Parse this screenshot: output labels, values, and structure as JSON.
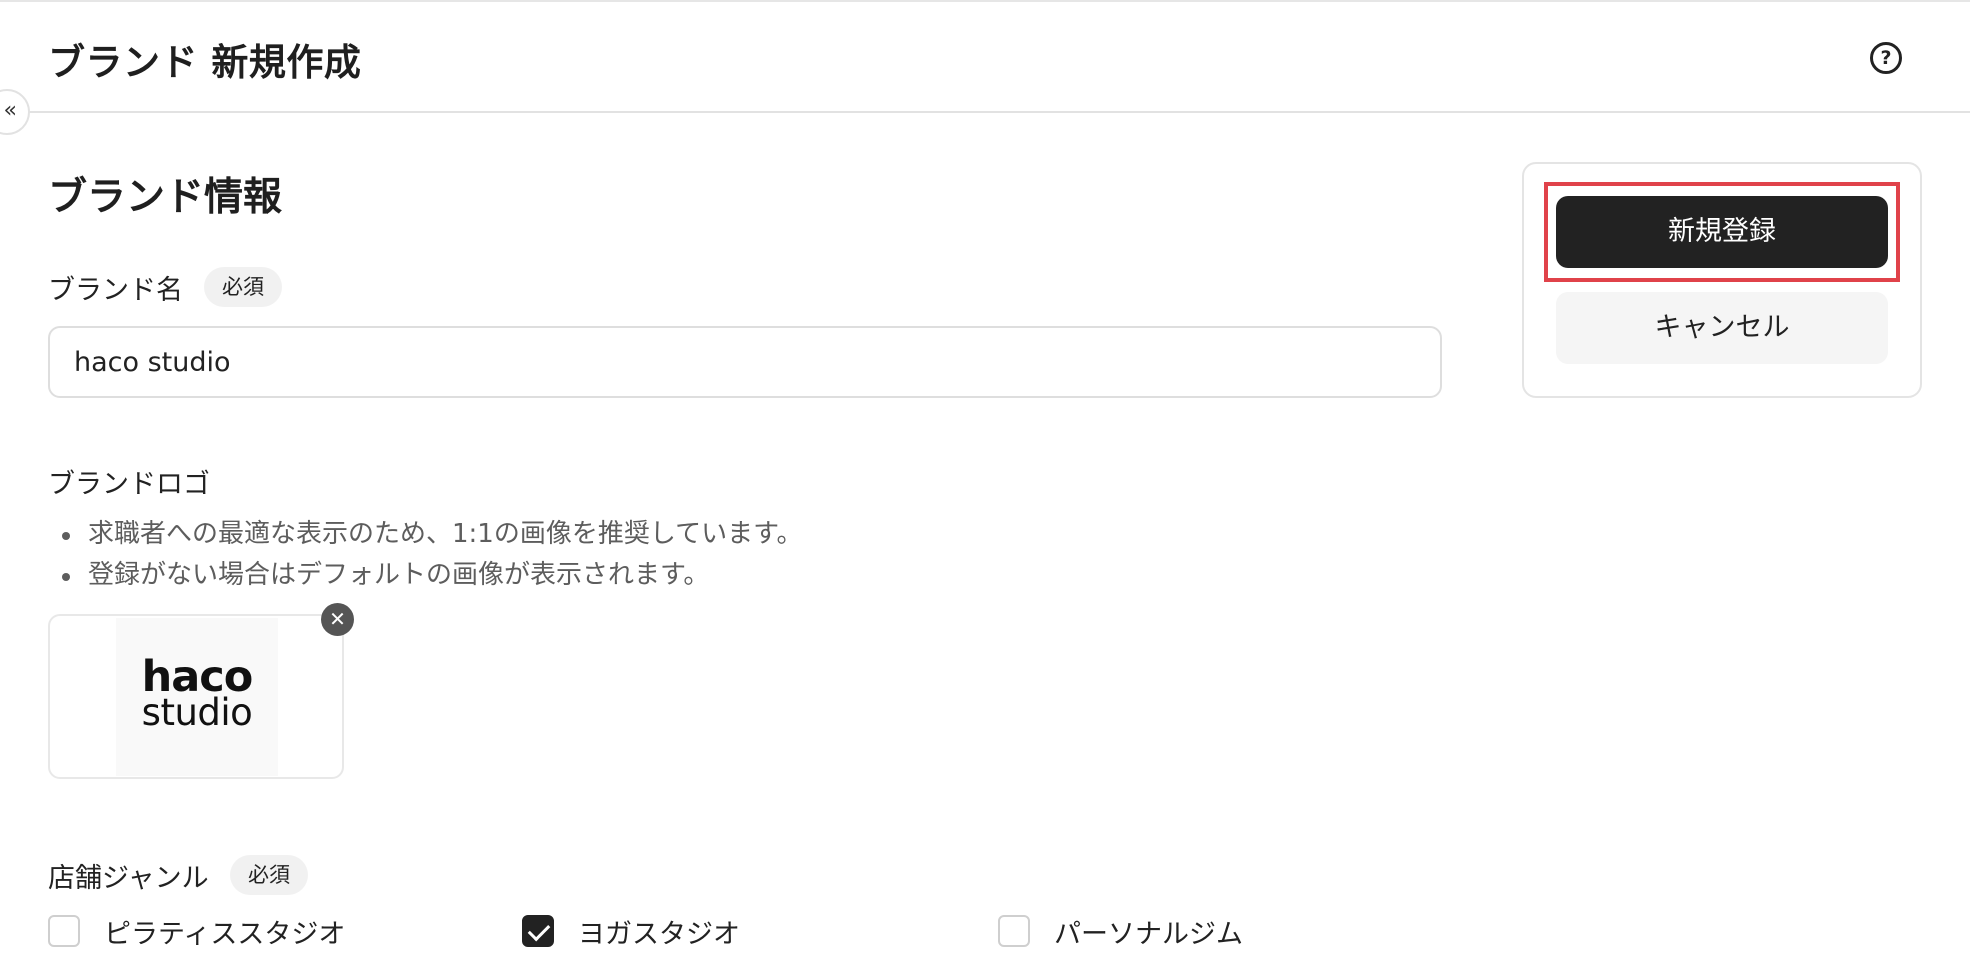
{
  "header": {
    "title": "ブランド 新規作成",
    "help_glyph": "?",
    "help_icon": "help-circle-icon"
  },
  "sidebar_toggle": {
    "glyph": "«",
    "icon": "collapse-chevrons-icon"
  },
  "form": {
    "section_title": "ブランド情報",
    "brand_name": {
      "label": "ブランド名",
      "required_badge": "必須",
      "value": "haco studio"
    },
    "brand_logo": {
      "label": "ブランドロゴ",
      "hints": [
        "求職者への最適な表示のため、1:1の画像を推奨しています。",
        "登録がない場合はデフォルトの画像が表示されます。"
      ],
      "logo_line1": "haco",
      "logo_line2": "studio",
      "remove_glyph": "✕",
      "remove_icon": "close-icon"
    },
    "store_genre": {
      "label": "店舗ジャンル",
      "required_badge": "必須",
      "options": [
        {
          "label": "ピラティススタジオ",
          "checked": false
        },
        {
          "label": "ヨガスタジオ",
          "checked": true
        },
        {
          "label": "パーソナルジム",
          "checked": false
        }
      ]
    }
  },
  "actions": {
    "submit_label": "新規登録",
    "cancel_label": "キャンセル",
    "highlight_color": "#e0424a"
  }
}
